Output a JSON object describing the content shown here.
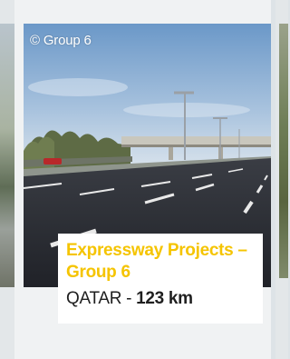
{
  "card": {
    "copyright": "© Group 6",
    "title": "Expressway Projects – Group 6",
    "country": "QATAR",
    "separator": " - ",
    "distance": "123 km"
  },
  "colors": {
    "title_accent": "#f5c400",
    "page_background": "#dde3e7",
    "caption_background": "#ffffff"
  }
}
